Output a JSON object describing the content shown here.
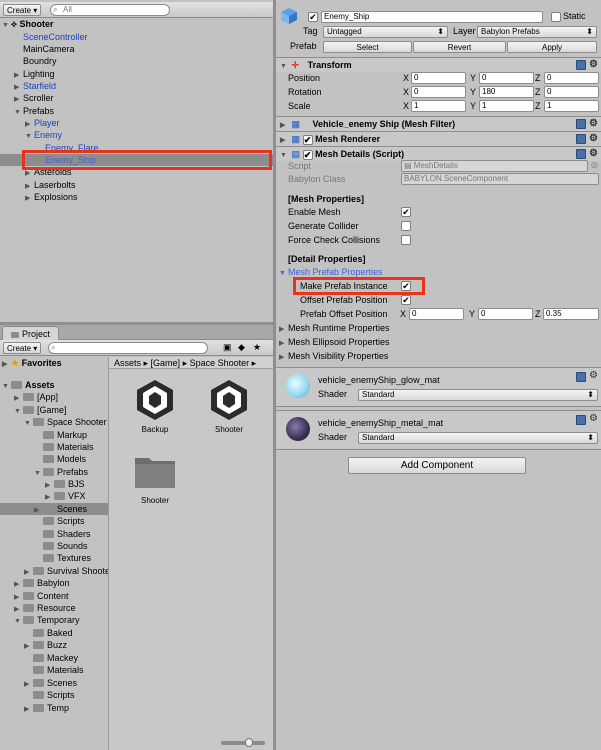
{
  "hierarchy": {
    "create_label": "Create",
    "search_placeholder": "All",
    "scene_name": "Shooter",
    "items": [
      "SceneController",
      "MainCamera",
      "Boundry",
      "Lighting",
      "Starfield",
      "Scroller",
      "Prefabs",
      "Player",
      "Enemy",
      "Enemy_Flare",
      "Enemy_Ship",
      "Asteroids",
      "Laserbolts",
      "Explosions"
    ]
  },
  "project": {
    "tab_label": "Project",
    "create_label": "Create",
    "favorites_label": "Favorites",
    "breadcrumb": [
      "Assets",
      "[Game]",
      "Space Shooter"
    ],
    "tree": [
      "Assets",
      "[App]",
      "[Game]",
      "Space Shooter",
      "Markup",
      "Materials",
      "Models",
      "Prefabs",
      "BJS",
      "VFX",
      "Scenes",
      "Scripts",
      "Shaders",
      "Sounds",
      "Textures",
      "Survival Shooter",
      "Babylon",
      "Content",
      "Resource",
      "Temporary",
      "Baked",
      "Buzz",
      "Mackey",
      "Materials",
      "Scenes",
      "Scripts",
      "Temp"
    ],
    "assets": [
      "Backup",
      "Shooter",
      "Shooter"
    ]
  },
  "inspector": {
    "object_name": "Enemy_Ship",
    "static_label": "Static",
    "tag_label": "Tag",
    "tag_value": "Untagged",
    "layer_label": "Layer",
    "layer_value": "Babylon Prefabs",
    "prefab_label": "Prefab",
    "select_label": "Select",
    "revert_label": "Revert",
    "apply_label": "Apply",
    "transform": {
      "title": "Transform",
      "position_label": "Position",
      "position": [
        "0",
        "0",
        "0"
      ],
      "rotation_label": "Rotation",
      "rotation": [
        "0",
        "180",
        "0"
      ],
      "scale_label": "Scale",
      "scale": [
        "1",
        "1",
        "1"
      ],
      "axes": [
        "X",
        "Y",
        "Z"
      ]
    },
    "mesh_filter_title": "Vehicle_enemy Ship (Mesh Filter)",
    "mesh_renderer_title": "Mesh Renderer",
    "mesh_details": {
      "title": "Mesh Details (Script)",
      "script_label": "Script",
      "script_value": "MeshDetails",
      "babylon_class_label": "Babylon Class",
      "babylon_class_value": "BABYLON.SceneComponent",
      "mesh_properties_header": "[Mesh Properties]",
      "enable_mesh": "Enable Mesh",
      "generate_collider": "Generate Collider",
      "force_check": "Force Check Collisions",
      "detail_header": "[Detail Properties]",
      "prefab_props": "Mesh Prefab Properties",
      "make_prefab": "Make Prefab Instance",
      "offset_position": "Offset Prefab Position",
      "prefab_offset_position": "Prefab Offset Position",
      "offset_values": [
        "0",
        "0",
        "0.35"
      ],
      "runtime": "Mesh Runtime Properties",
      "ellipsoid": "Mesh Ellipsoid Properties",
      "visibility": "Mesh Visibility Properties"
    },
    "materials": [
      {
        "name": "vehicle_enemyShip_glow_mat",
        "shader_label": "Shader",
        "shader": "Standard"
      },
      {
        "name": "vehicle_enemyShip_metal_mat",
        "shader_label": "Shader",
        "shader": "Standard"
      }
    ],
    "add_component": "Add Component"
  },
  "colors": {
    "highlight": "#e8341c",
    "link": "#1f3fbf"
  }
}
